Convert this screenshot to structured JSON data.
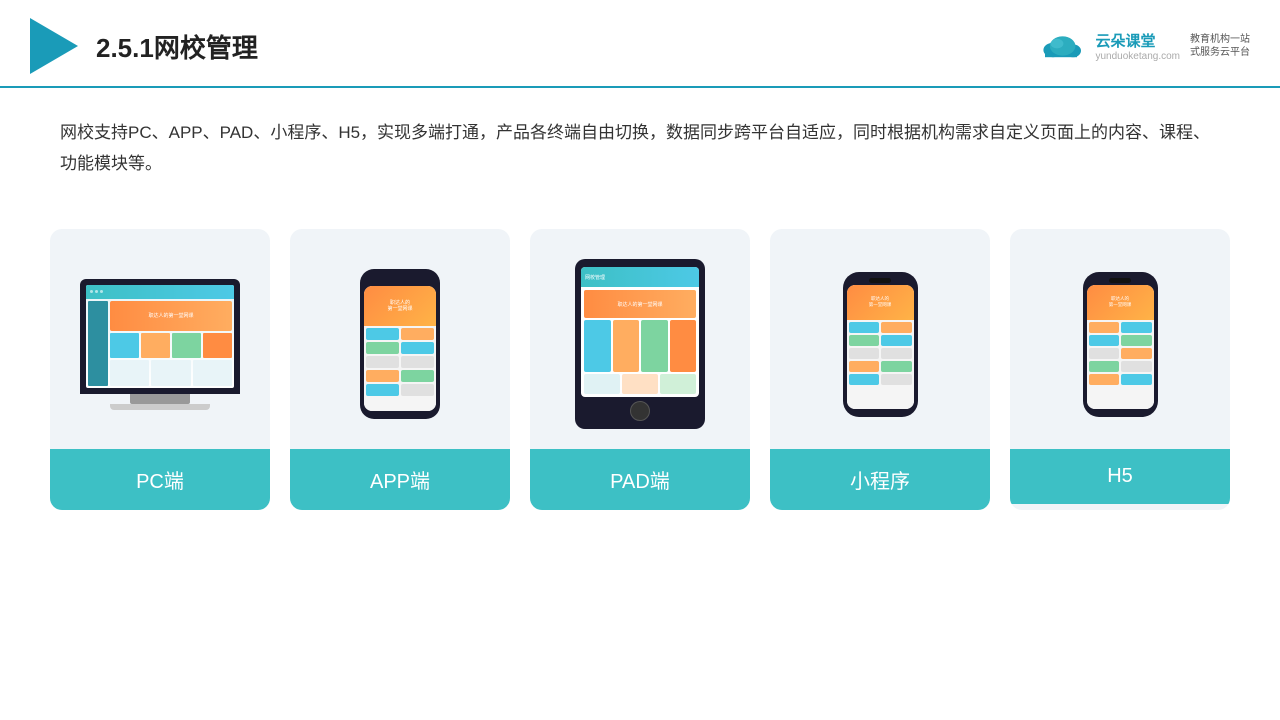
{
  "header": {
    "title": "2.5.1网校管理",
    "brand_name": "云朵课堂",
    "brand_url": "yunduoketang.com",
    "brand_slogan": "教育机构一站\n式服务云平台"
  },
  "description": {
    "text": "网校支持PC、APP、PAD、小程序、H5，实现多端打通，产品各终端自由切换，数据同步跨平台自适应，同时根据机构需求自定义页面上的内容、课程、功能模块等。"
  },
  "cards": [
    {
      "id": "pc",
      "label": "PC端"
    },
    {
      "id": "app",
      "label": "APP端"
    },
    {
      "id": "pad",
      "label": "PAD端"
    },
    {
      "id": "miniprogram",
      "label": "小程序"
    },
    {
      "id": "h5",
      "label": "H5"
    }
  ],
  "colors": {
    "accent": "#3dc0c5",
    "header_line": "#1a9bb8",
    "card_bg": "#f0f4f8",
    "card_label_bg": "#3dc0c5"
  }
}
